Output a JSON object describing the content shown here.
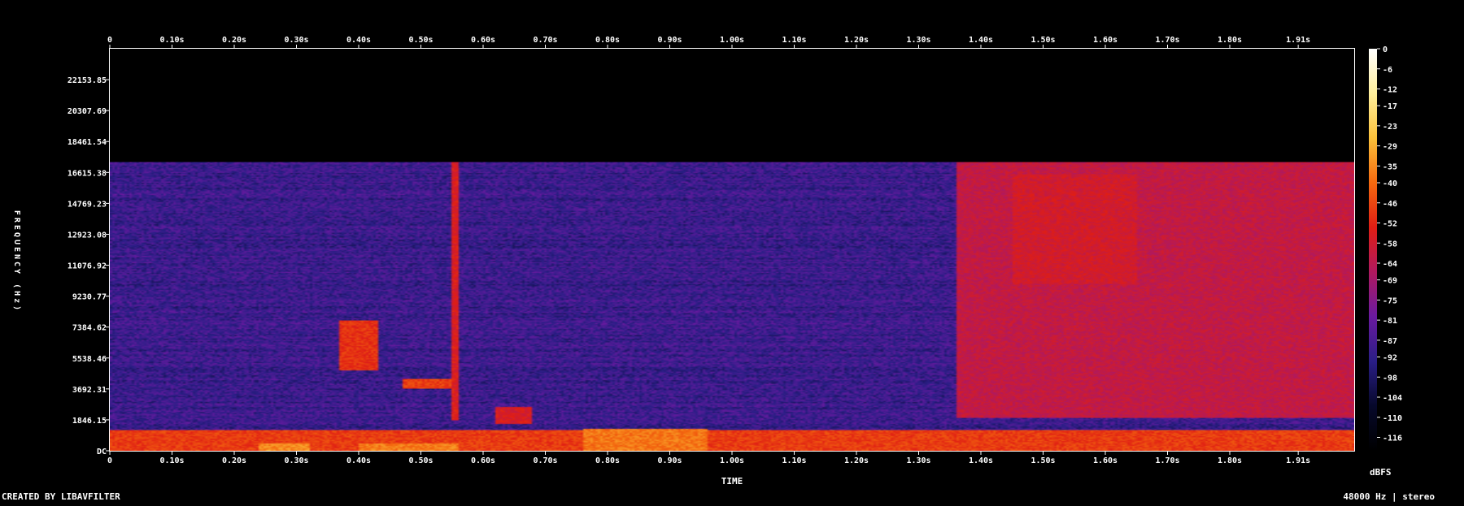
{
  "chart_data": {
    "type": "heatmap",
    "title": "",
    "xlabel": "TIME",
    "ylabel": "FREQUENCY (Hz)",
    "x_ticks": [
      "0",
      "0.10s",
      "0.20s",
      "0.30s",
      "0.40s",
      "0.50s",
      "0.60s",
      "0.70s",
      "0.80s",
      "0.90s",
      "1.00s",
      "1.10s",
      "1.20s",
      "1.30s",
      "1.40s",
      "1.50s",
      "1.60s",
      "1.70s",
      "1.80s",
      "1.91s"
    ],
    "x_tick_values": [
      0,
      0.1,
      0.2,
      0.3,
      0.4,
      0.5,
      0.6,
      0.7,
      0.8,
      0.9,
      1.0,
      1.1,
      1.2,
      1.3,
      1.4,
      1.5,
      1.6,
      1.7,
      1.8,
      1.91
    ],
    "xlim": [
      0,
      2.0
    ],
    "y_ticks": [
      "DC",
      "1846.15",
      "3692.31",
      "5538.46",
      "7384.62",
      "9230.77",
      "11076.92",
      "12923.08",
      "14769.23",
      "16615.38",
      "18461.54",
      "20307.69",
      "22153.85"
    ],
    "y_tick_values": [
      0,
      1846.15,
      3692.31,
      5538.46,
      7384.62,
      9230.77,
      11076.92,
      12923.08,
      14769.23,
      16615.38,
      18461.54,
      20307.69,
      22153.85
    ],
    "ylim": [
      0,
      24000
    ],
    "colorbar": {
      "label": "dBFS",
      "ticks": [
        "0",
        "-6",
        "-12",
        "-17",
        "-23",
        "-29",
        "-35",
        "-40",
        "-46",
        "-52",
        "-58",
        "-64",
        "-69",
        "-75",
        "-81",
        "-87",
        "-92",
        "-98",
        "-104",
        "-110",
        "-116"
      ],
      "range": [
        -120,
        0
      ]
    },
    "content_cutoff_hz": 17200,
    "background_level_dbfs": -90,
    "features": [
      {
        "t0": 0.0,
        "t1": 2.0,
        "f0": 0,
        "f1": 1200,
        "db": -48
      },
      {
        "t0": 0.24,
        "t1": 0.32,
        "f0": 0,
        "f1": 400,
        "db": -35
      },
      {
        "t0": 0.4,
        "t1": 0.56,
        "f0": 0,
        "f1": 400,
        "db": -37
      },
      {
        "t0": 0.76,
        "t1": 0.96,
        "f0": 0,
        "f1": 1300,
        "db": -38
      },
      {
        "t0": 0.55,
        "t1": 0.56,
        "f0": 1800,
        "f1": 17200,
        "db": -55
      },
      {
        "t0": 0.37,
        "t1": 0.43,
        "f0": 4800,
        "f1": 7800,
        "db": -50
      },
      {
        "t0": 0.47,
        "t1": 0.55,
        "f0": 3700,
        "f1": 4300,
        "db": -48
      },
      {
        "t0": 0.62,
        "t1": 0.68,
        "f0": 1600,
        "f1": 2600,
        "db": -56
      },
      {
        "t0": 1.36,
        "t1": 2.0,
        "f0": 2000,
        "f1": 17200,
        "db": -62
      },
      {
        "t0": 1.45,
        "t1": 1.65,
        "f0": 10000,
        "f1": 16500,
        "db": -58
      }
    ]
  },
  "footer": {
    "credit": "CREATED BY LIBAVFILTER",
    "sample_info": "48000 Hz | stereo"
  },
  "palette": {
    "text": "#ffffff",
    "background": "#000000",
    "colormap": [
      "#ffffff",
      "#ffef9c",
      "#fbc13a",
      "#f4690f",
      "#e01e14",
      "#b0195f",
      "#6a1aa0",
      "#2a1e86",
      "#06082a",
      "#000000"
    ]
  }
}
